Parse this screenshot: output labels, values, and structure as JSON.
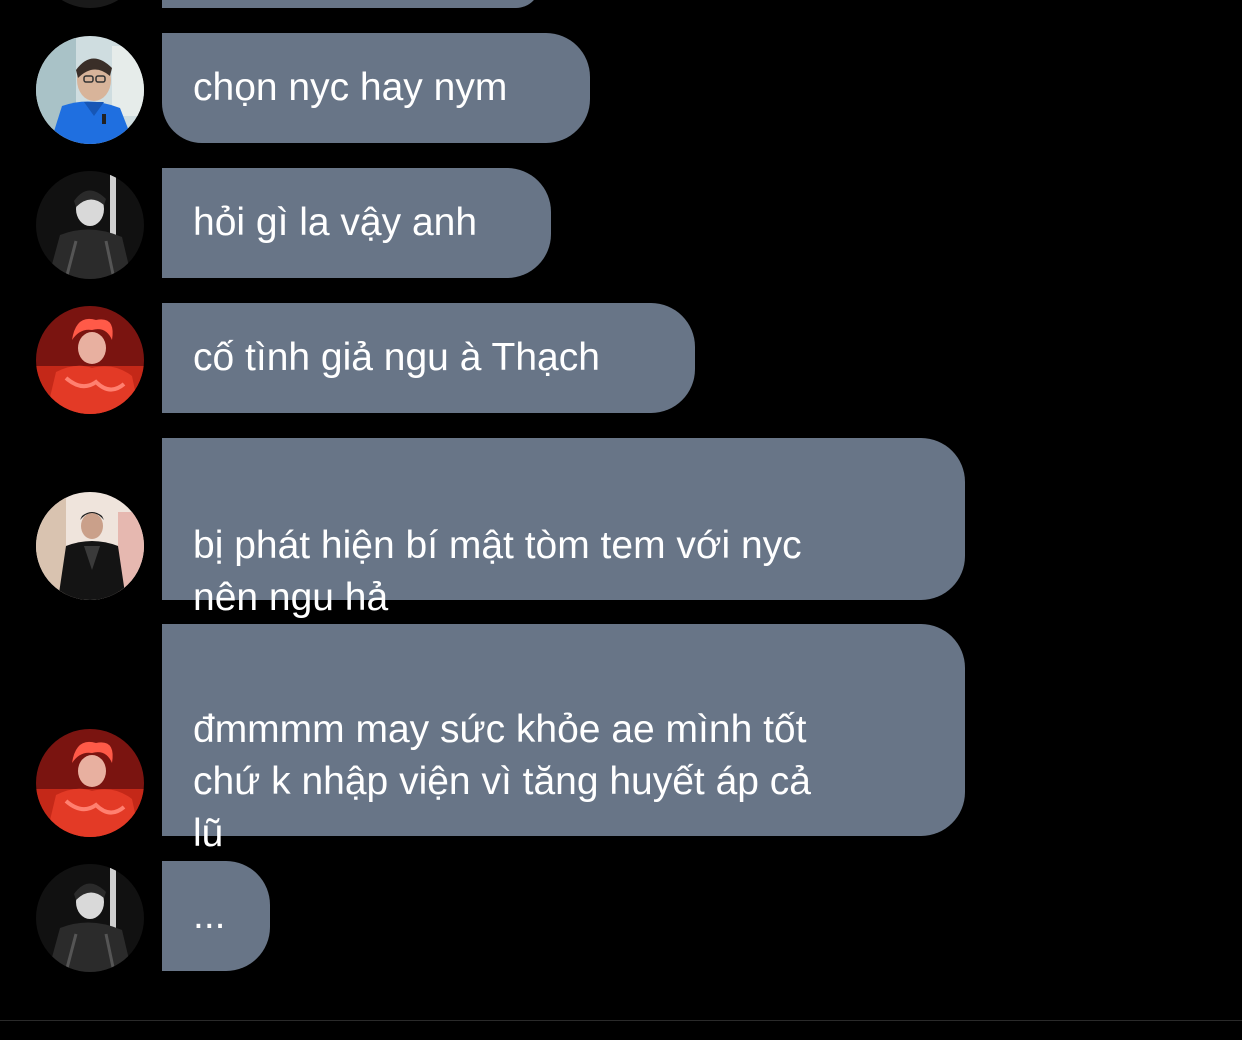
{
  "messages": [
    {
      "avatar": "avatar-blue-shirt",
      "text": "chọn nyc hay nym"
    },
    {
      "avatar": "avatar-black-white",
      "text": "hỏi gì la vậy anh"
    },
    {
      "avatar": "avatar-red",
      "text": "cố tình giả ngu à Thạch"
    },
    {
      "avatar": "avatar-leather-jacket",
      "text": "bị phát hiện bí mật tòm tem với nyc\nnên ngu hả"
    },
    {
      "avatar": "avatar-red",
      "text": "đmmmm may sức khỏe ae mình tốt\nchứ k nhập viện vì tăng huyết áp cả\nlũ"
    },
    {
      "avatar": "avatar-black-white",
      "text": "..."
    }
  ],
  "colors": {
    "background": "#000000",
    "bubble": "#687587",
    "text": "#ffffff"
  }
}
